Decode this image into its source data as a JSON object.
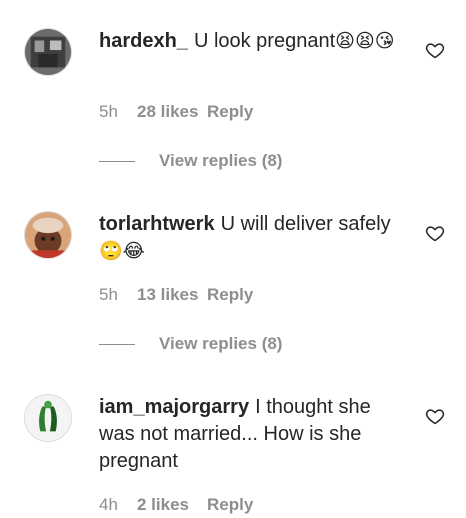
{
  "comments": [
    {
      "username": "hardexh_",
      "text": "U look pregnant",
      "emojis": "😫😫😘",
      "time": "5h",
      "likes": "28 likes",
      "reply_label": "Reply",
      "view_replies": "View replies (8)",
      "avatar_icon": "profile-photo-building"
    },
    {
      "username": "torlarhtwerk",
      "text": "U will deliver safely",
      "emojis": "🙄😂",
      "time": "5h",
      "likes": "13 likes",
      "reply_label": "Reply",
      "view_replies": "View replies (8)",
      "avatar_icon": "profile-photo-person"
    },
    {
      "username": "iam_majorgarry",
      "text": "I thought she was not married... How is she pregnant",
      "emojis": "",
      "time": "4h",
      "likes": "2 likes",
      "reply_label": "Reply",
      "avatar_icon": "profile-photo-logo"
    }
  ],
  "colors": {
    "text_primary": "#262626",
    "text_secondary": "#8e8e8e",
    "background": "#ffffff"
  },
  "icons": {
    "like": "heart-outline-icon"
  }
}
